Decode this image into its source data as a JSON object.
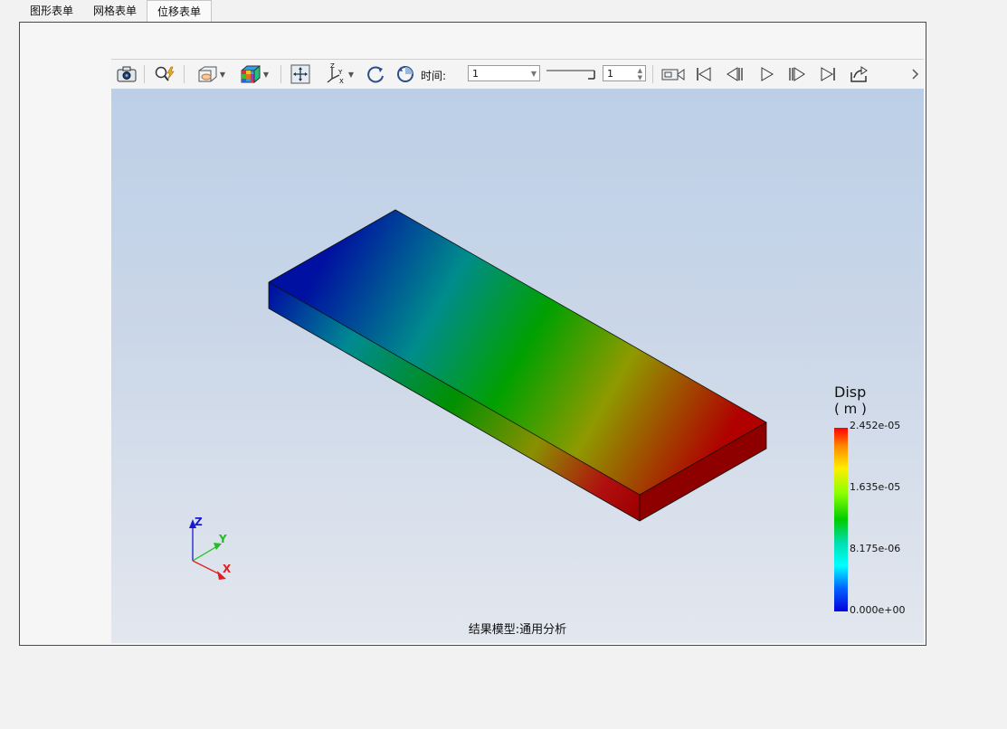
{
  "tabs": [
    {
      "label": "图形表单",
      "active": false
    },
    {
      "label": "网格表单",
      "active": false
    },
    {
      "label": "位移表单",
      "active": true
    }
  ],
  "toolbar": {
    "time_label": "时间:",
    "time_value": "1",
    "step_value": "1",
    "icons": [
      "camera-icon",
      "query-icon",
      "section-view-icon",
      "color-cube-icon",
      "fit-view-icon",
      "axis-view-icon",
      "rotate-cw-icon",
      "rotate-ccw-icon",
      "record-icon",
      "first-frame-icon",
      "prev-frame-icon",
      "play-icon",
      "next-frame-icon",
      "last-frame-icon",
      "export-icon"
    ]
  },
  "legend": {
    "title": "Disp",
    "unit": "( m )",
    "max": "2.452e-05",
    "v2": "1.635e-05",
    "v3": "8.175e-06",
    "min": "0.000e+00"
  },
  "triad": {
    "x": "X",
    "y": "Y",
    "z": "Z",
    "x_color": "#e02020",
    "y_color": "#20c020",
    "z_color": "#1a1acc"
  },
  "footer": {
    "model_label": "结果模型:通用分析"
  },
  "colors": {
    "contour_max": "#cc0000",
    "contour_mid": "#00a000",
    "contour_min": "#0000aa"
  }
}
